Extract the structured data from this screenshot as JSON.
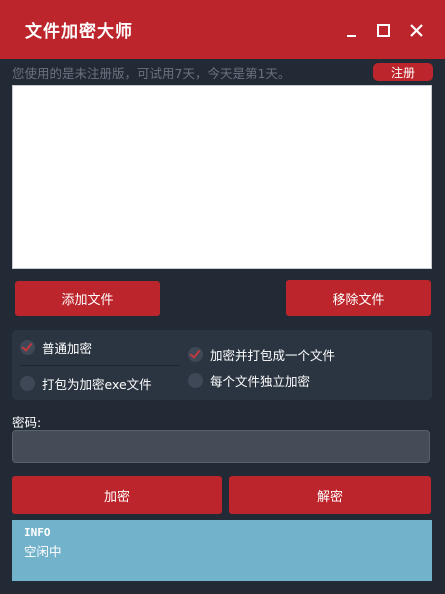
{
  "app": {
    "title": "文件加密大师"
  },
  "window_controls": {
    "minimize": "minimize-icon",
    "maximize": "maximize-icon",
    "close": "close-icon"
  },
  "trial": {
    "notice": "您使用的是未注册版，可试用7天，今天是第1天。",
    "register_label": "注册"
  },
  "file_actions": {
    "add_label": "添加文件",
    "remove_label": "移除文件"
  },
  "options": {
    "normal_encrypt": "普通加密",
    "pack_exe": "打包为加密exe文件",
    "merge_one": "加密并打包成一个文件",
    "individual": "每个文件独立加密"
  },
  "password": {
    "label": "密码:",
    "value": ""
  },
  "actions": {
    "encrypt_label": "加密",
    "decrypt_label": "解密"
  },
  "info": {
    "title": "INFO",
    "status": "空闲中"
  },
  "colors": {
    "accent": "#bc252b",
    "background": "#222a35",
    "info_panel": "#72b2cb"
  }
}
